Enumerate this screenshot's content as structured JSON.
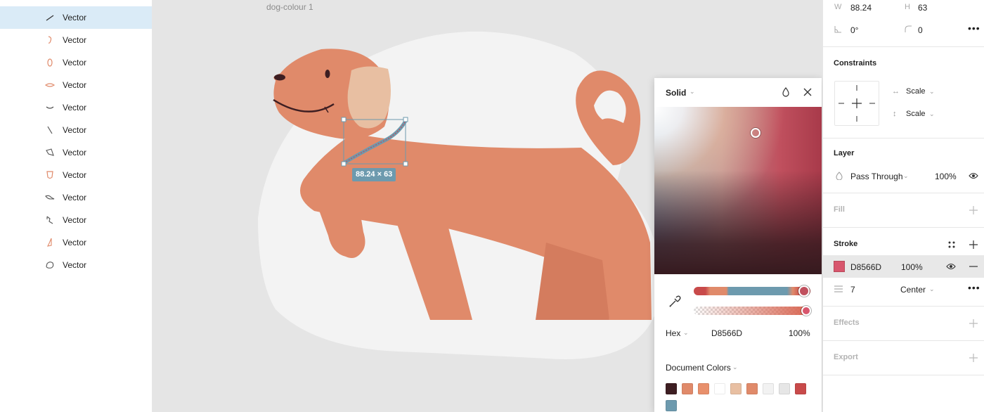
{
  "layers": {
    "items": [
      {
        "label": "Vector",
        "icon": "vector-line-icon",
        "selected": true
      },
      {
        "label": "Vector",
        "icon": "vector-ear-icon"
      },
      {
        "label": "Vector",
        "icon": "vector-oval-icon"
      },
      {
        "label": "Vector",
        "icon": "vector-lens-icon"
      },
      {
        "label": "Vector",
        "icon": "vector-arc-icon"
      },
      {
        "label": "Vector",
        "icon": "vector-slash-icon"
      },
      {
        "label": "Vector",
        "icon": "vector-leaf-icon"
      },
      {
        "label": "Vector",
        "icon": "vector-cup-icon"
      },
      {
        "label": "Vector",
        "icon": "vector-fish-icon"
      },
      {
        "label": "Vector",
        "icon": "vector-hook-icon"
      },
      {
        "label": "Vector",
        "icon": "vector-paw-icon"
      },
      {
        "label": "Vector",
        "icon": "vector-blob-icon"
      }
    ]
  },
  "canvas": {
    "frame_name": "dog-colour 1",
    "selection_size": "88.24 × 63"
  },
  "picker": {
    "fill_type": "Solid",
    "color_model": "Hex",
    "hex": "D8566D",
    "opacity": "100%",
    "document_colors_label": "Document Colors",
    "document_colors": [
      "#3d1e22",
      "#e08a6a",
      "#e8906c",
      "#ffffff",
      "#e8bfa2",
      "#e08a6a",
      "#f2f2f2",
      "#e6e6e6",
      "#c84a4a",
      "#6d9aae"
    ],
    "hue_fraction": 0.94,
    "alpha_fraction": 1.0
  },
  "props": {
    "w_label": "W",
    "w_value": "88.24",
    "h_label": "H",
    "h_value": "63",
    "rotation": "0°",
    "radius": "0",
    "constraints_title": "Constraints",
    "constraint_h": "Scale",
    "constraint_v": "Scale",
    "layer_title": "Layer",
    "blend_mode": "Pass Through",
    "layer_opacity": "100%",
    "fill_title": "Fill",
    "stroke_title": "Stroke",
    "stroke_hex": "D8566D",
    "stroke_opacity": "100%",
    "stroke_weight": "7",
    "stroke_align": "Center",
    "effects_title": "Effects",
    "export_title": "Export"
  },
  "colors": {
    "selection_blue": "#daebf7",
    "accent_blue": "#18a0fb",
    "stroke_color": "#d8566d",
    "dog_body": "#e08a6a",
    "dog_ear": "#e8bfa2"
  }
}
